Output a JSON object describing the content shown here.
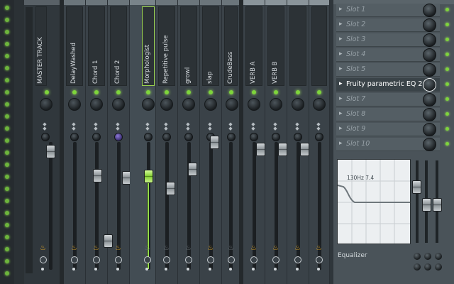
{
  "mixer": {
    "tracks": [
      {
        "name": "MASTER TRACK"
      },
      {
        "name": "DelayWashed"
      },
      {
        "name": "Chord 1"
      },
      {
        "name": "Chord 2"
      },
      {
        "name": "Morphologist"
      },
      {
        "name": "Repetitive pulse"
      },
      {
        "name": "growl"
      },
      {
        "name": "slap"
      },
      {
        "name": "CrudeBass"
      },
      {
        "name": "VERB A"
      },
      {
        "name": "VERB B"
      }
    ]
  },
  "effects": {
    "slots": [
      {
        "label": "Slot 1",
        "active": false
      },
      {
        "label": "Slot 2",
        "active": false
      },
      {
        "label": "Slot 3",
        "active": false
      },
      {
        "label": "Slot 4",
        "active": false
      },
      {
        "label": "Slot 5",
        "active": false
      },
      {
        "label": "Fruity parametric EQ 2",
        "active": true
      },
      {
        "label": "Slot 7",
        "active": false
      },
      {
        "label": "Slot 8",
        "active": false
      },
      {
        "label": "Slot 9",
        "active": false
      },
      {
        "label": "Slot 10",
        "active": false
      }
    ],
    "eq_readout": "130Hz 7.4",
    "eq_title": "Equalizer"
  },
  "colors": {
    "accent_green": "#7ed53b",
    "slot_knob_active": "#e8ecee",
    "send_icon": "#e2a92a"
  }
}
